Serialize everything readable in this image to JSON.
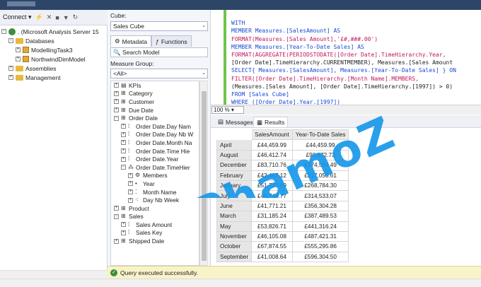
{
  "object_explorer": {
    "connect_label": "Connect ▾",
    "tree": [
      {
        "label": ". (Microsoft Analysis Server 15",
        "level": 0
      },
      {
        "label": "Databases",
        "level": 1
      },
      {
        "label": "ModellingTask3",
        "level": 2
      },
      {
        "label": "NorthwindDimModel",
        "level": 2
      },
      {
        "label": "Assemblies",
        "level": 1
      },
      {
        "label": "Management",
        "level": 1
      }
    ]
  },
  "metadata": {
    "cube_label": "Cube:",
    "cube_value": "Sales Cube",
    "tab_metadata": "Metadata",
    "tab_functions": "Functions",
    "search_placeholder": "Search Model",
    "measure_group_label": "Measure Group:",
    "measure_group_value": "<All>",
    "tree": [
      {
        "label": "KPIs",
        "icon": "kpi"
      },
      {
        "label": "Category",
        "icon": "dim"
      },
      {
        "label": "Customer",
        "icon": "dim"
      },
      {
        "label": "Due Date",
        "icon": "dim"
      },
      {
        "label": "Order Date",
        "icon": "dim"
      },
      {
        "label": "Order Date.Day Nam",
        "icon": "hier"
      },
      {
        "label": "Order Date.Day Nb W",
        "icon": "hier"
      },
      {
        "label": "Order Date.Month Na",
        "icon": "hier"
      },
      {
        "label": "Order Date.Time Hie",
        "icon": "hier"
      },
      {
        "label": "Order Date.Year",
        "icon": "hier"
      },
      {
        "label": "Order Date.TimeHier",
        "icon": "hier"
      },
      {
        "label": "Members",
        "icon": "mem"
      },
      {
        "label": "Year",
        "icon": "lvl"
      },
      {
        "label": "Month Name",
        "icon": "lvl"
      },
      {
        "label": "Day Nb Week",
        "icon": "lvl"
      },
      {
        "label": "Product",
        "icon": "dim"
      },
      {
        "label": "Sales",
        "icon": "dim"
      },
      {
        "label": "Sales Amount",
        "icon": "meas"
      },
      {
        "label": "Sales Key",
        "icon": "meas"
      },
      {
        "label": "Shipped Date",
        "icon": "dim"
      }
    ]
  },
  "editor": {
    "lines": [
      "WITH",
      "MEMBER Measures.[SalesAmount] AS",
      "FORMAT(Measures.[Sales Amount],'£#,###.00')",
      "MEMBER Measures.[Year-To-Date Sales] AS",
      "FORMAT(AGGREGATE(PERIODSTODATE([Order Date].TimeHierarchy.Year,",
      "[Order Date].TimeHierarchy.CURRENTMEMBER), Measures.[Sales Amount",
      "SELECT{ Measures.[SalesAmount], Measures.[Year-To-Date Sales] } ON",
      "FILTER([Order Date].TimeHierarchy.[Month Name].MEMBERS,",
      "(Measures.[Sales Amount], [Order Date].TimeHierarchy.[1997]) > 0)",
      "FROM [Sales Cube]",
      "WHERE ([Order Date].Year.[1997])"
    ],
    "zoom": "100 %"
  },
  "results": {
    "tab_messages": "Messages",
    "tab_results": "Results",
    "columns": [
      "SalesAmount",
      "Year-To-Date Sales"
    ],
    "rows": [
      {
        "month": "April",
        "sales": "£44,459.99",
        "ytd": "£44,459.99"
      },
      {
        "month": "August",
        "sales": "£46,412.74",
        "ytd": "£90,872.73"
      },
      {
        "month": "December",
        "sales": "£83,710.76",
        "ytd": "£174,583.49"
      },
      {
        "month": "February",
        "sales": "£42,467.12",
        "ytd": "£217,050.61"
      },
      {
        "month": "January",
        "sales": "£51,733.69",
        "ytd": "£268,784.30"
      },
      {
        "month": "July",
        "sales": "£45,748.77",
        "ytd": "£314,533.07"
      },
      {
        "month": "June",
        "sales": "£41,771.21",
        "ytd": "£356,304.28"
      },
      {
        "month": "March",
        "sales": "£31,185.24",
        "ytd": "£387,489.53"
      },
      {
        "month": "May",
        "sales": "£53,826.71",
        "ytd": "£441,316.24"
      },
      {
        "month": "November",
        "sales": "£46,105.08",
        "ytd": "£487,421.31"
      },
      {
        "month": "October",
        "sales": "£67,874.55",
        "ytd": "£555,295.86"
      },
      {
        "month": "September",
        "sales": "£41,008.64",
        "ytd": "£596,304.50"
      }
    ]
  },
  "status": {
    "text": "Query executed successfully."
  },
  "watermark": {
    "text": "PhamoZ"
  },
  "colors": {
    "accent": "#1596e8",
    "keyword": "#1b49d8",
    "function": "#c2185b",
    "string": "#c0392b",
    "status_bg": "#f9f3c9"
  }
}
